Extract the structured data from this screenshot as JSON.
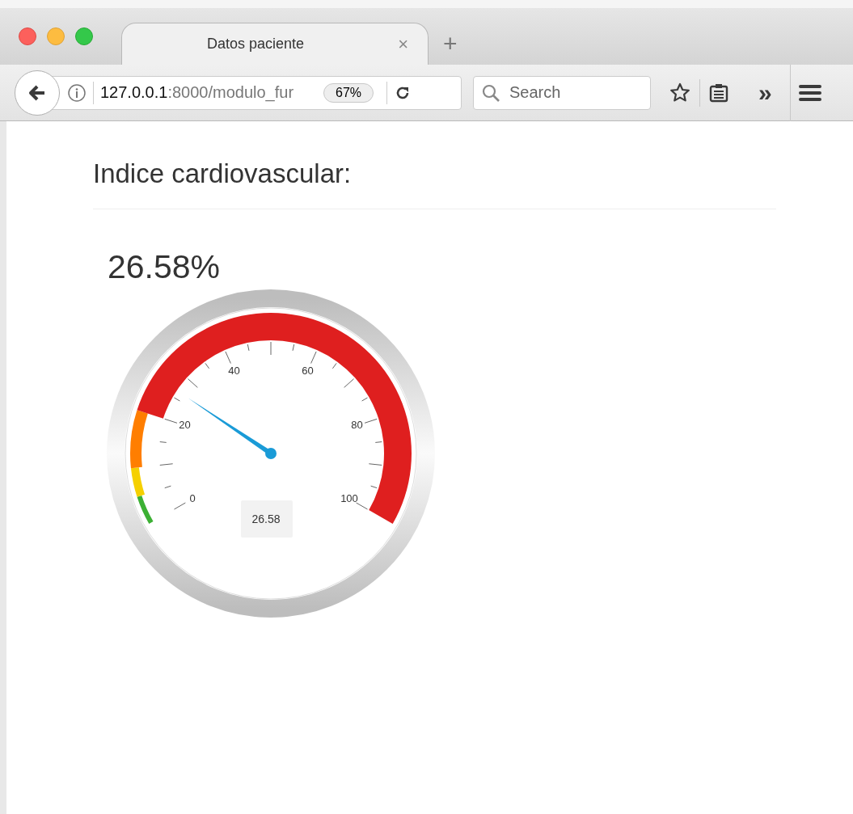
{
  "window": {
    "tab": {
      "title": "Datos paciente",
      "close": "×",
      "selected": true
    },
    "new_tab": "+"
  },
  "toolbar": {
    "url": {
      "host": "127.0.0.1",
      "rest": ":8000/modulo_fur"
    },
    "zoom": "67%",
    "search": {
      "placeholder": "Search"
    },
    "overflow": "»"
  },
  "page": {
    "heading": "Indice cardiovascular:",
    "value": "26.58%",
    "gauge": {
      "tick_labels": [
        "0",
        "20",
        "40",
        "60",
        "80",
        "100"
      ],
      "level": 0.2658,
      "reading": "26.58",
      "bands": [
        {
          "color": "#3cb034"
        },
        {
          "color": "#f5d000"
        },
        {
          "color": "#ff7e00"
        },
        {
          "color": "#df1f1f"
        }
      ]
    }
  }
}
